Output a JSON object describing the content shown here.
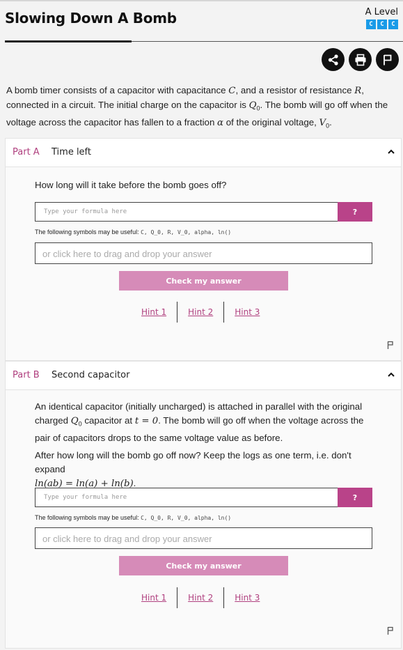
{
  "header": {
    "title": "Slowing Down A Bomb",
    "level_label": "A Level",
    "level_boxes": [
      "C",
      "C",
      "C"
    ]
  },
  "actions": {
    "share_icon": "share-icon",
    "print_icon": "print-icon",
    "flag_icon": "flag-icon"
  },
  "intro": {
    "t1": "A bomb timer consists of a capacitor with capacitance ",
    "C": "C",
    "t2": ", and a resistor of resistance ",
    "R": "R",
    "t3": ", connected in a circuit. The initial charge on the capacitor is ",
    "Q0": "Q",
    "Q0sub": "0",
    "t4": ". The bomb will go off when the voltage across the capacitor has fallen to a fraction ",
    "alpha": "α",
    "t5": " of the original voltage, ",
    "V0": "V",
    "V0sub": "0",
    "t6": "."
  },
  "partA": {
    "letter": "Part A",
    "title": "Time left",
    "question": "How long will it take before the bomb goes off?",
    "formula_placeholder": "Type your formula here",
    "help_label": "?",
    "symbols_label": "The following symbols may be useful: ",
    "symbols": "C, Q_0, R, V_0, alpha, ln()",
    "drop_placeholder": "or click here to drag and drop your answer",
    "check_label": "Check my answer",
    "hints": [
      "Hint 1",
      "Hint 2",
      "Hint 3"
    ]
  },
  "partB": {
    "letter": "Part B",
    "title": "Second capacitor",
    "q1a": "An identical capacitor (initially uncharged) is attached in parallel with the original charged ",
    "q1Q": "Q",
    "q1Qsub": "0",
    "q1b": " capacitor at ",
    "q1t": "t = 0",
    "q1c": ". The bomb will go off when the voltage across the pair of capacitors drops to the same voltage value as before.",
    "q2a": "After how long will the bomb go off now? Keep the logs as one term, i.e. don't expand",
    "q2math": "ln(ab) = ln(a) + ln(b)",
    "q2b": ".",
    "formula_placeholder": "Type your formula here",
    "help_label": "?",
    "symbols_label": "The following symbols may be useful: ",
    "symbols": "C, Q_0, R, V_0, alpha, ln()",
    "drop_placeholder": "or click here to drag and drop your answer",
    "check_label": "Check my answer",
    "hints": [
      "Hint 1",
      "Hint 2",
      "Hint 3"
    ]
  }
}
